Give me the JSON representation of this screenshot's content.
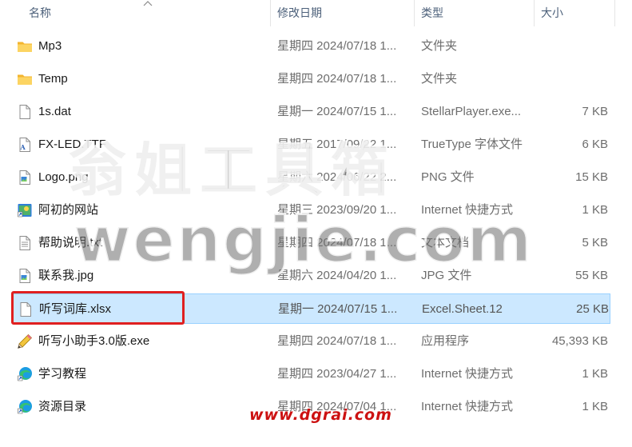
{
  "header": {
    "name": "名称",
    "date": "修改日期",
    "type": "类型",
    "size": "大小"
  },
  "rows": [
    {
      "name": "Mp3",
      "date": "星期四 2024/07/18 1...",
      "type": "文件夹",
      "size": "",
      "icon": "folder-icon"
    },
    {
      "name": "Temp",
      "date": "星期四 2024/07/18 1...",
      "type": "文件夹",
      "size": "",
      "icon": "folder-icon"
    },
    {
      "name": "1s.dat",
      "date": "星期一 2024/07/15 1...",
      "type": "StellarPlayer.exe...",
      "size": "7 KB",
      "icon": "file-icon"
    },
    {
      "name": "FX-LED.TTF",
      "date": "星期五 2017/09/22 1...",
      "type": "TrueType 字体文件",
      "size": "6 KB",
      "icon": "font-file-icon"
    },
    {
      "name": "Logo.png",
      "date": "星期六 2024/06/22 2...",
      "type": "PNG 文件",
      "size": "15 KB",
      "icon": "image-file-icon"
    },
    {
      "name": "阿初的网站",
      "date": "星期三 2023/09/20 1...",
      "type": "Internet 快捷方式",
      "size": "1 KB",
      "icon": "internet-shortcut-icon"
    },
    {
      "name": "帮助说明.txt",
      "date": "星期四 2024/07/18 1...",
      "type": "文本文档",
      "size": "5 KB",
      "icon": "text-file-icon"
    },
    {
      "name": "联系我.jpg",
      "date": "星期六 2024/04/20 1...",
      "type": "JPG 文件",
      "size": "55 KB",
      "icon": "image-file-icon"
    },
    {
      "name": "听写词库.xlsx",
      "date": "星期一 2024/07/15 1...",
      "type": "Excel.Sheet.12",
      "size": "25 KB",
      "icon": "file-icon",
      "selected": true
    },
    {
      "name": "听写小助手3.0版.exe",
      "date": "星期四 2024/07/18 1...",
      "type": "应用程序",
      "size": "45,393 KB",
      "icon": "pencil-app-icon"
    },
    {
      "name": "学习教程",
      "date": "星期四 2023/04/27 1...",
      "type": "Internet 快捷方式",
      "size": "1 KB",
      "icon": "edge-shortcut-icon"
    },
    {
      "name": "资源目录",
      "date": "星期四 2024/07/04 1...",
      "type": "Internet 快捷方式",
      "size": "1 KB",
      "icon": "edge-shortcut-icon"
    }
  ],
  "watermarks": {
    "cn": "翁姐工具箱",
    "domain": "wengjie.com",
    "site": "www.dgrai.com"
  },
  "colors": {
    "selected_bg": "#cce8ff",
    "selected_border": "#99d1ff",
    "annotation": "#e02020",
    "folder": "#f8c74a"
  }
}
